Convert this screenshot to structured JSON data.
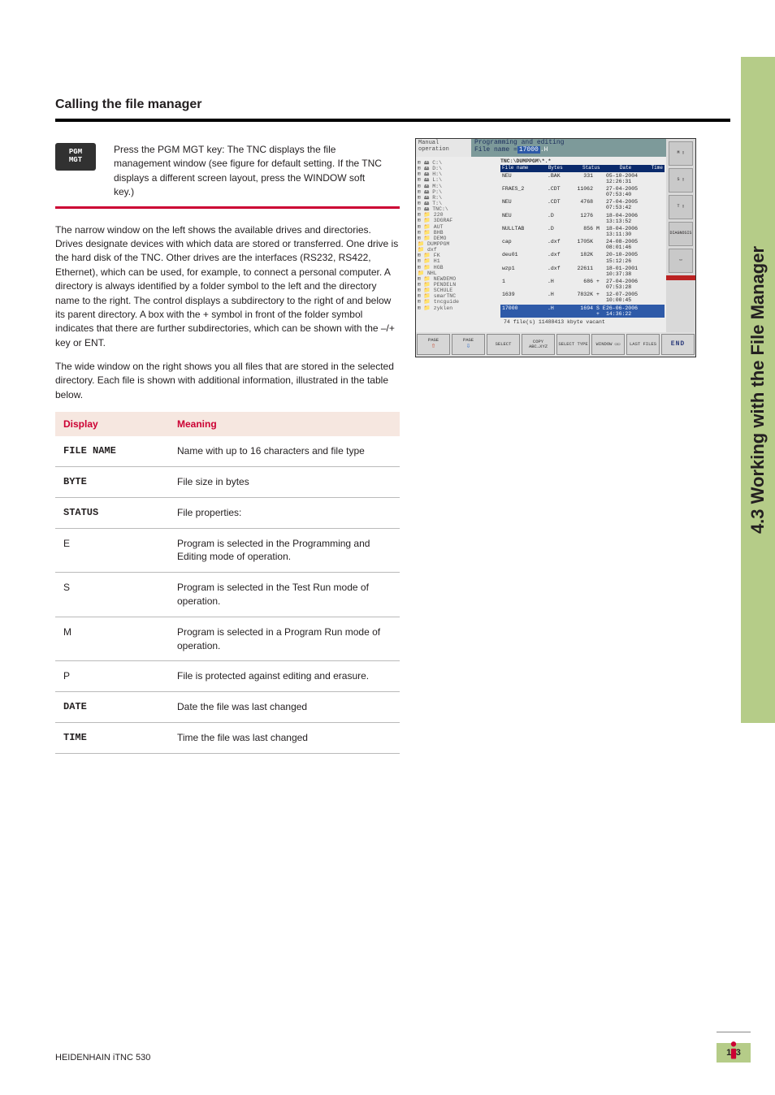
{
  "side_tab": "4.3 Working with the File Manager",
  "section": {
    "heading": "Calling the file manager",
    "key_label": "PGM\nMGT",
    "key_text": "Press the PGM MGT key: The TNC displays the file management window (see figure for default setting. If the TNC displays a different screen layout, press the WINDOW soft key.)",
    "para1": "The narrow window on the left shows the available drives and directories. Drives designate devices with which data are stored or transferred. One drive is the hard disk of the TNC. Other drives are the interfaces (RS232, RS422, Ethernet), which can be used, for example, to connect a personal computer. A directory is always identified by a folder symbol to the left and the directory name to the right. The control displays a subdirectory to the right of and below its parent directory. A box with the + symbol in front of the folder symbol indicates that there are further subdirectories, which can be shown with the –/+ key or ENT.",
    "para2": "The wide window on the right shows you all files that are stored in the selected directory. Each file is shown with additional information, illustrated in the table below."
  },
  "table": {
    "headers": [
      "Display",
      "Meaning"
    ],
    "rows": [
      {
        "label": "FILE NAME",
        "mono": true,
        "meaning": "Name with up to 16 characters and file type"
      },
      {
        "label": "BYTE",
        "mono": true,
        "meaning": "File size in bytes"
      },
      {
        "label": "STATUS",
        "mono": true,
        "meaning": "File properties:"
      },
      {
        "label": "E",
        "mono": false,
        "meaning": "Program is selected in the Programming and Editing mode of operation."
      },
      {
        "label": "S",
        "mono": false,
        "meaning": "Program is selected in the Test Run mode of operation."
      },
      {
        "label": "M",
        "mono": false,
        "meaning": "Program is selected in a Program Run mode of operation."
      },
      {
        "label": "P",
        "mono": false,
        "meaning": "File is protected against editing and erasure."
      },
      {
        "label": "DATE",
        "mono": true,
        "meaning": "Date the file was last changed"
      },
      {
        "label": "TIME",
        "mono": true,
        "meaning": "Time the file was last changed"
      }
    ]
  },
  "shot": {
    "mode": "Manual operation",
    "title": "Programming and editing",
    "subtitle_prefix": "File name =",
    "subtitle_hl": "17000",
    "subtitle_ext": ".H",
    "path": "TNC:\\DUMPPGM\\*.*",
    "table_head": [
      "File name",
      "Bytes",
      "Status",
      "Date",
      "Time"
    ],
    "rows": [
      [
        "NEU",
        ".BAK",
        "331",
        "",
        "05-10-2004 12:26:31"
      ],
      [
        "FRAES_2",
        ".CDT",
        "11062",
        "",
        "27-04-2005 07:53:40"
      ],
      [
        "NEU",
        ".CDT",
        "4768",
        "",
        "27-04-2005 07:53:42"
      ],
      [
        "NEU",
        ".D",
        "1276",
        "",
        "18-04-2006 13:13:52"
      ],
      [
        "NULLTAB",
        ".D",
        "856",
        "M",
        "18-04-2006 13:11:30"
      ],
      [
        "cap",
        ".dxf",
        "1705K",
        "",
        "24-08-2005 08:01:46"
      ],
      [
        "deu01",
        ".dxf",
        "182K",
        "",
        "20-10-2005 15:12:26"
      ],
      [
        "wzp1",
        ".dxf",
        "22611",
        "",
        "18-01-2001 10:37:38"
      ],
      [
        "1",
        ".H",
        "686",
        "+",
        "27-04-2006 07:53:28"
      ],
      [
        "1639",
        ".H",
        "7832K",
        "+",
        "12-07-2005 10:00:45"
      ],
      [
        "17000",
        ".H",
        "1694",
        "S E +",
        "26-06-2006 14:36:22"
      ]
    ],
    "vacant": "74  file(s) 11488413 kbyte vacant",
    "tree": [
      "⊞ 🖴 C:\\",
      "⊞ 🖴 D:\\",
      "⊞ 🖴 H:\\",
      "⊞ 🖴 L:\\",
      "⊞ 🖴 M:\\",
      "⊞ 🖴 P:\\",
      "⊞ 🖴 R:\\",
      "⊞ 🖴 T:\\",
      "⊟ 🖴 TNC:\\",
      "  ⊞ 📁 220",
      "  ⊞ 📁 3DGRAF",
      "  ⊞ 📁 AUT",
      "  ⊞ 📁 BHB",
      "  ⊞ 📁 DEMO",
      "    📁 DUMPPGM",
      "    📁 dxf",
      "  ⊞ 📁 FK",
      "  ⊞ 📁 H1",
      "  ⊞ 📁 HGB",
      "    📁 NHL",
      "  ⊞ 📁 NEWDEMO",
      "  ⊞ 📁 PENDELN",
      "  ⊞ 📁 SCHULE",
      "  ⊞ 📁 smarTNC",
      "  ⊞ 📁 tncguide",
      "  ⊞ 📁 zyklen"
    ],
    "right_slots": [
      "M ▯",
      "S ▯",
      "T ▯",
      "DIAGNOSIS",
      "▭"
    ],
    "softkeys": [
      "PAGE↑",
      "PAGE↓",
      "SELECT",
      "COPY ABC→XYZ",
      "SELECT TYPE",
      "WINDOW ▭▭",
      "LAST FILES",
      "END"
    ]
  },
  "footer": {
    "left": "HEIDENHAIN iTNC 530",
    "page": "113"
  }
}
